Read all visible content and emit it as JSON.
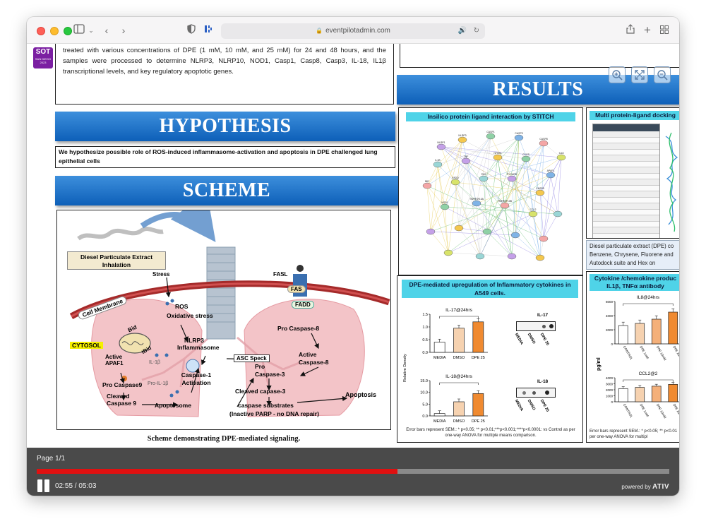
{
  "browser": {
    "url": "eventpilotadmin.com"
  },
  "logo": {
    "line1": "SOT",
    "line2": "SAN DIEGO 2023"
  },
  "poster": {
    "intro_text": "treated with various concentrations of DPE (1 mM, 10 mM, and 25 mM) for 24 and 48 hours, and the samples were processed to determine NLRP3, NLRP10, NOD1, Casp1, Casp8, Casp3, IL-18, IL1β transcriptional levels, and key regulatory apoptotic genes.",
    "hypothesis_heading": "HYPOTHESIS",
    "hypothesis_text": "We hypothesize possible role of ROS-induced inflammasome-activation and apoptosis in DPE challenged lung epithelial cells",
    "scheme_heading": "SCHEME",
    "scheme_caption": "Scheme demonstrating DPE-mediated signaling.",
    "results_heading": "RESULTS",
    "scheme_labels": {
      "inhalation": "Diesel Particulate Extract Inhalation",
      "stress": "Stress",
      "fasl": "FASL",
      "fas": "FAS",
      "fadd": "FADD",
      "cell_membrane": "Cell Membrane",
      "ros": "ROS",
      "oxidative_stress": "Oxidative stress",
      "nlrp3": "NLRP3",
      "inflammasome": "Inflammasome",
      "cytosol": "CYTOSOL",
      "bid": "Bid",
      "tbid": "tBid",
      "il1b": "IL-1β",
      "active_apaf1": "Active APAF1",
      "pro_il1b": "Pro-IL-1β",
      "pro_caspase9": "Pro Caspase9",
      "cleaved_caspase9": "Cleaved Caspase 9",
      "apoptosome": "Apoptosome",
      "caspase1": "Caspase-1 Activation",
      "asc_speck": "ASC Speck",
      "pro_caspase8": "Pro Caspase-8",
      "active_caspase8": "Active Caspase-8",
      "pro_caspase3": "Pro Caspase-3",
      "cleaved_caspase3": "Cleaved capase-3",
      "caspase_substrates": "caspase substrates",
      "inactive_parp": "(Inactive PARP - no DNA repair)",
      "apoptosis": "Apoptosis"
    },
    "stitch_panel": {
      "title": "Insilico protein ligand interaction by STITCH",
      "node_labels": [
        "NLRP1",
        "NLRP3",
        "CASP1",
        "CASP3",
        "CASP8",
        "IL18",
        "IL1B",
        "TNF",
        "NFKB1",
        "CYCS",
        "APAF1",
        "BID",
        "FADD",
        "FAS",
        "PYCARD",
        "CASP9",
        "NOD1",
        "TNFRSF10A",
        "TNFRSF10B",
        "CCL2"
      ]
    },
    "docking_panel": {
      "title": "Multi protein-ligand docking",
      "table_headers": [
        "Model",
        "Solution",
        "Score",
        "ΔG",
        "Δ"
      ],
      "description": "Diesel particulate extract (DPE) co Benzene, Chrysene, Fluorene and Autodock suite and Hex on SAMSON"
    },
    "cytokine_panel": {
      "title": "DPE-mediated upregulation of Inflammatory cytokines in A549 cells.",
      "il17_title": "IL-17@24hrs",
      "il18_title": "IL-18@24hrs",
      "blot_il17": "IL-17",
      "blot_il18": "IL-18",
      "ylabel": "Relative Density",
      "categories": [
        "MEDIA",
        "DMSO",
        "DPE 25"
      ],
      "footnote": "Error bars represent SEM.: * p<0.05; ** p<0.01;***p<0.001;****p<0.0001: vs Control as per one-way ANOVA for multiple means comparison."
    },
    "chemokine_panel": {
      "title": "Cytokine /chemokine produc IL1β, TNFα antibody",
      "il8_title": "IL8@24hrs",
      "ccl2_title": "CCL2@2",
      "ylabel": "pg/ml",
      "categories": [
        "CONTROL",
        "DPE 1mM",
        "DPE 10mM",
        "DPE 25mM"
      ],
      "footnote": "Error bars represent SEM.: * p<0.05; ** p<0.01 per one-way ANOVA for multipl"
    }
  },
  "chart_data": [
    {
      "type": "bar",
      "title": "IL-17@24hrs",
      "ylabel": "Relative Density",
      "categories": [
        "MEDIA",
        "DMSO",
        "DPE 25"
      ],
      "values": [
        0.4,
        0.95,
        1.2
      ],
      "ylim": [
        0,
        1.5
      ],
      "yticks": [
        "0.0",
        "0.5",
        "1.0",
        "1.5"
      ],
      "colors": [
        "#ffffff",
        "#f6d2b0",
        "#f08a30"
      ]
    },
    {
      "type": "bar",
      "title": "IL-18@24hrs",
      "ylabel": "Relative Density",
      "categories": [
        "MEDIA",
        "DMSO",
        "DPE 25"
      ],
      "values": [
        1.0,
        6.0,
        9.5
      ],
      "ylim": [
        0,
        15
      ],
      "yticks": [
        "0.0",
        "5.0",
        "10.0",
        "15.0"
      ],
      "colors": [
        "#ffffff",
        "#f6d2b0",
        "#f08a30"
      ]
    },
    {
      "type": "bar",
      "title": "IL8@24hrs",
      "ylabel": "pg/ml",
      "categories": [
        "CONTROL",
        "DPE 1mM",
        "DPE 10mM",
        "DPE 25mM"
      ],
      "values": [
        2600,
        2900,
        3500,
        4500
      ],
      "ylim": [
        0,
        6000
      ],
      "yticks": [
        "0",
        "2000",
        "4000",
        "6000"
      ],
      "colors": [
        "#ffffff",
        "#f6d2b0",
        "#f4b07a",
        "#f08a30"
      ]
    },
    {
      "type": "bar",
      "title": "CCL2@2",
      "ylabel": "pg/ml",
      "categories": [
        "CONTROL",
        "DPE 1mM",
        "DPE 10mM",
        "DPE 25mM"
      ],
      "values": [
        2200,
        2400,
        2600,
        2900
      ],
      "ylim": [
        0,
        4000
      ],
      "yticks": [
        "0",
        "1000",
        "2000",
        "3000",
        "4000"
      ],
      "colors": [
        "#ffffff",
        "#f6d2b0",
        "#f4b07a",
        "#f08a30"
      ]
    }
  ],
  "player": {
    "page_label": "Page 1/1",
    "time": "02:55 / 05:03",
    "progress": 0.57,
    "powered_by": "powered by",
    "brand": "ATIV"
  }
}
